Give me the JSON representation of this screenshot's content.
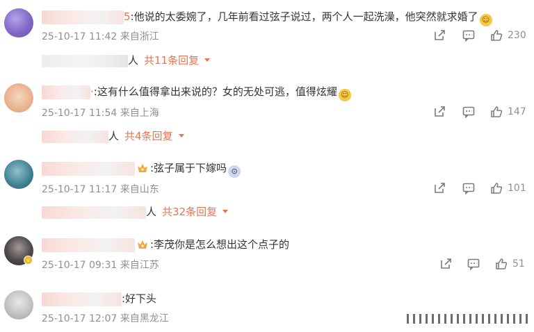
{
  "comments": [
    {
      "name_tail": "5",
      "text": ":他说的太委婉了，几年前看过弦子说过，两个人一起洗澡，他突然就求婚了",
      "date": "25-10-17 11:42",
      "source": "来自浙江",
      "likes": "230",
      "reply_name_tail": "人",
      "reply_text": "共11条回复"
    },
    {
      "name_tail": "·",
      "text": ":这有什么值得拿出来说的？女的无处可逃，值得炫耀",
      "date": "25-10-17 11:54",
      "source": "来自上海",
      "likes": "147",
      "reply_name_tail": "人",
      "reply_text": "共4条回复"
    },
    {
      "name_tail": "",
      "text": ":弦子属于下嫁吗",
      "date": "25-10-17 11:17",
      "source": "来自山东",
      "likes": "101",
      "reply_name_tail": "人",
      "reply_text": "共32条回复"
    },
    {
      "name_tail": "",
      "text": ":李茂你是怎么想出这个点子的",
      "date": "25-10-17 09:31",
      "source": "来自江苏",
      "likes": "51"
    },
    {
      "name_tail": "",
      "text": ":好下头",
      "date": "25-10-17 12:07",
      "source": "来自黑龙江",
      "likes": ""
    }
  ],
  "icons": {
    "share": "share-icon",
    "comment": "comment-icon",
    "like": "like-icon",
    "crown": "crown-icon"
  },
  "colors": {
    "accent": "#eb7350",
    "meta": "#8f8f8f",
    "icon": "#7a7a7a"
  }
}
